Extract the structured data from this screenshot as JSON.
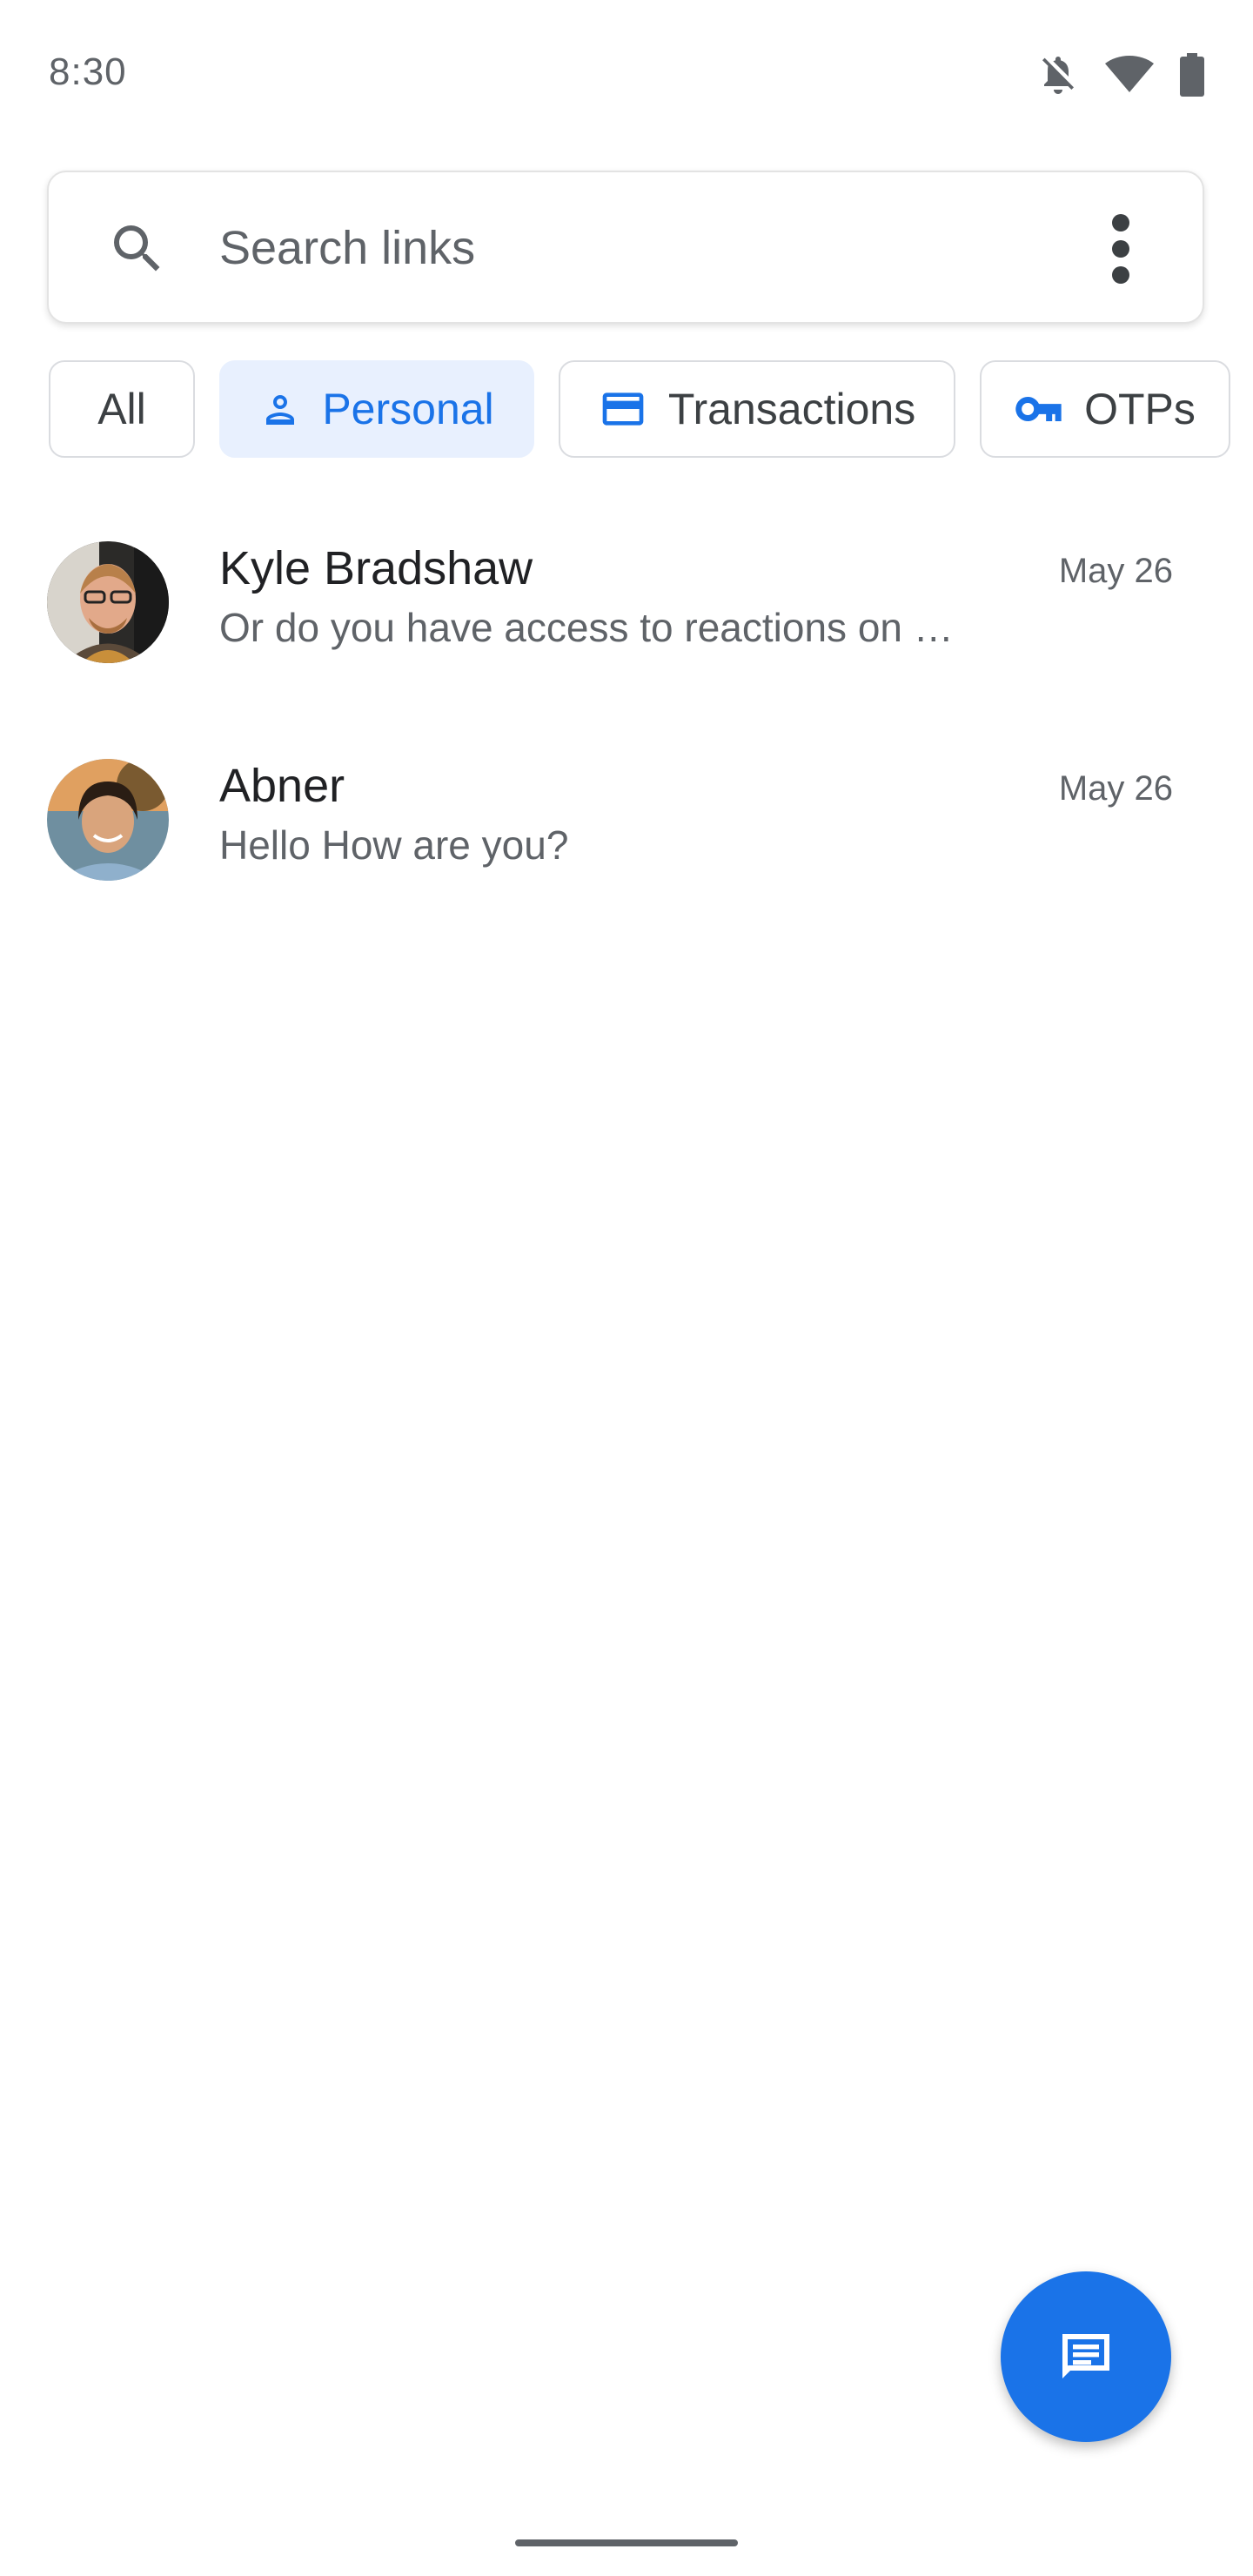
{
  "status_bar": {
    "time": "8:30",
    "icons": [
      "notifications-off-icon",
      "wifi-icon",
      "battery-icon"
    ]
  },
  "search": {
    "placeholder": "Search links",
    "icon": "search-icon",
    "menu_icon": "more-vert-icon"
  },
  "filters": [
    {
      "label": "All",
      "selected": false,
      "icon": null
    },
    {
      "label": "Personal",
      "selected": true,
      "icon": "person-icon"
    },
    {
      "label": "Transactions",
      "selected": false,
      "icon": "credit-card-icon"
    },
    {
      "label": "OTPs",
      "selected": false,
      "icon": "key-icon"
    }
  ],
  "conversations": [
    {
      "name": "Kyle Bradshaw",
      "snippet": "Or do you have access to reactions on …",
      "date": "May 26"
    },
    {
      "name": "Abner",
      "snippet": "Hello How are you?",
      "date": "May 26"
    }
  ],
  "fab": {
    "icon": "start-chat-icon"
  },
  "colors": {
    "accent": "#1a73e8",
    "chip_selected_bg": "#e8f0fe",
    "text_primary": "#202124",
    "text_secondary": "#5f6368"
  }
}
